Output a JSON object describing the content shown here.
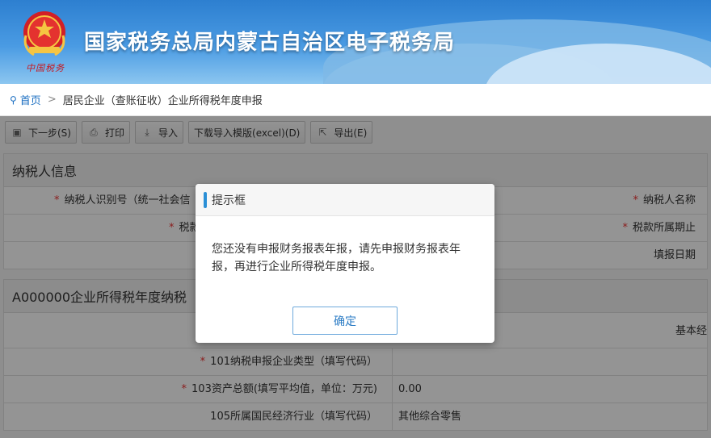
{
  "header": {
    "site_title": "国家税务总局内蒙古自治区电子税务局",
    "emblem_caption": "中国税务"
  },
  "breadcrumb": {
    "home": "首页",
    "separator": ">",
    "current": "居民企业（查账征收）企业所得税年度申报"
  },
  "toolbar": {
    "buttons": [
      {
        "label": "下一步(S)",
        "icon": "save-icon"
      },
      {
        "label": "打印",
        "icon": "print-icon"
      },
      {
        "label": "导入",
        "icon": "import-icon"
      },
      {
        "label": "下载导入模版(excel)(D)",
        "icon": ""
      },
      {
        "label": "导出(E)",
        "icon": "export-icon"
      }
    ]
  },
  "taxpayer_section": {
    "title": "纳税人信息",
    "row1": {
      "left_label": "纳税人识别号（统一社会信",
      "right_label": "纳税人名称"
    },
    "row2": {
      "left_label": "税款",
      "right_label": "税款所属期止"
    },
    "row3": {
      "right_label": "填报日期"
    }
  },
  "form_section": {
    "title": "A000000企业所得税年度纳税",
    "basic_label": "基本经",
    "rows": [
      {
        "label": "101纳税申报企业类型（填写代码）",
        "value": "",
        "required": true
      },
      {
        "label": "103资产总额(填写平均值，单位：万元)",
        "value": "0.00",
        "required": true
      },
      {
        "label": "105所属国民经济行业（填写代码）",
        "value": "其他综合零售",
        "required": false
      }
    ]
  },
  "dialog": {
    "title": "提示框",
    "message": "您还没有申报财务报表年报，请先申报财务报表年报，再进行企业所得税年度申报。",
    "confirm_label": "确定"
  },
  "colors": {
    "banner": "#3a8ad8",
    "accent": "#2a8fd6",
    "required": "#ee3333"
  }
}
